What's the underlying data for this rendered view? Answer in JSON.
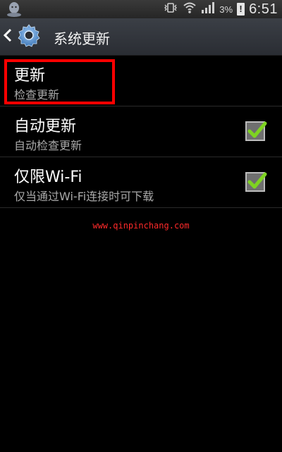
{
  "status_bar": {
    "battery_percent": "3%",
    "battery_alert": "!",
    "time": "6:51"
  },
  "action_bar": {
    "title": "系统更新"
  },
  "settings": {
    "items": [
      {
        "title": "更新",
        "subtitle": "检查更新"
      },
      {
        "title": "自动更新",
        "subtitle": "自动检查更新",
        "checked": true
      },
      {
        "title": "仅限Wi-Fi",
        "subtitle": "仅当通过Wi-Fi连接时可下载",
        "checked": true
      }
    ]
  },
  "watermark": "www.qinpinchang.com",
  "colors": {
    "check": "#7ed321",
    "highlight": "#ff0000",
    "watermark": "#ff2a2a"
  }
}
